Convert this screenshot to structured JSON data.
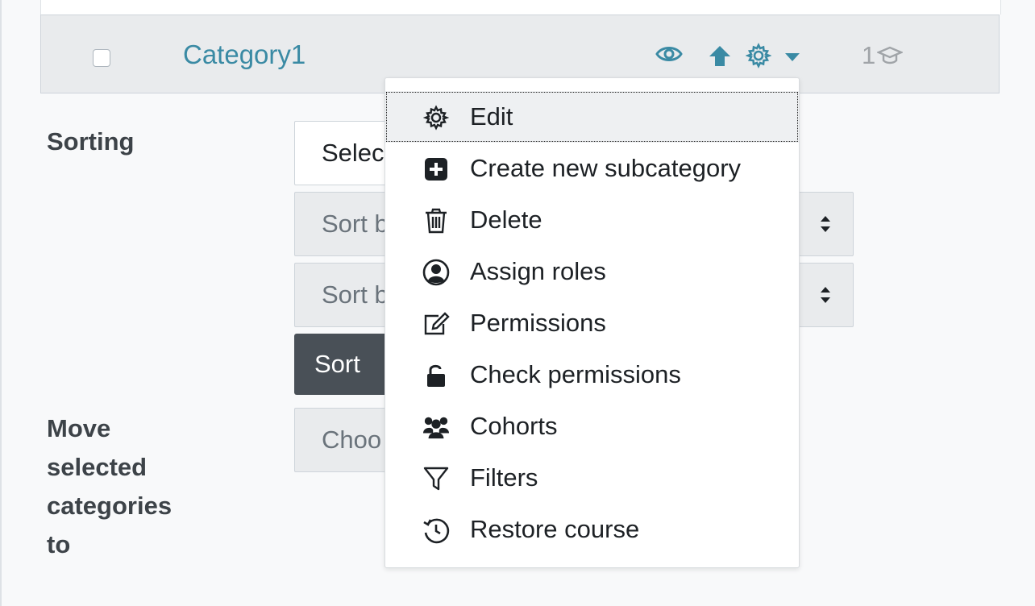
{
  "category": {
    "name": "Category1",
    "course_count": "1"
  },
  "sorting": {
    "label": "Sorting",
    "select_text": "Selec",
    "sort_by_1": "Sort b",
    "sort_by_2": "Sort b",
    "sort_button": "Sort"
  },
  "move": {
    "label_lines": [
      "Move",
      "selected",
      "categories",
      "to"
    ],
    "choose_text": "Choo"
  },
  "menu": {
    "items": [
      {
        "label": "Edit",
        "icon": "gear-icon"
      },
      {
        "label": "Create new subcategory",
        "icon": "plus-square-icon"
      },
      {
        "label": "Delete",
        "icon": "trash-icon"
      },
      {
        "label": "Assign roles",
        "icon": "user-circle-icon"
      },
      {
        "label": "Permissions",
        "icon": "edit-icon"
      },
      {
        "label": "Check permissions",
        "icon": "unlock-icon"
      },
      {
        "label": "Cohorts",
        "icon": "users-icon"
      },
      {
        "label": "Filters",
        "icon": "filter-icon"
      },
      {
        "label": "Restore course",
        "icon": "history-icon"
      }
    ]
  },
  "colors": {
    "link": "#3a8aa4",
    "icon_blue": "#3a8aa4",
    "button_dark": "#495057"
  }
}
